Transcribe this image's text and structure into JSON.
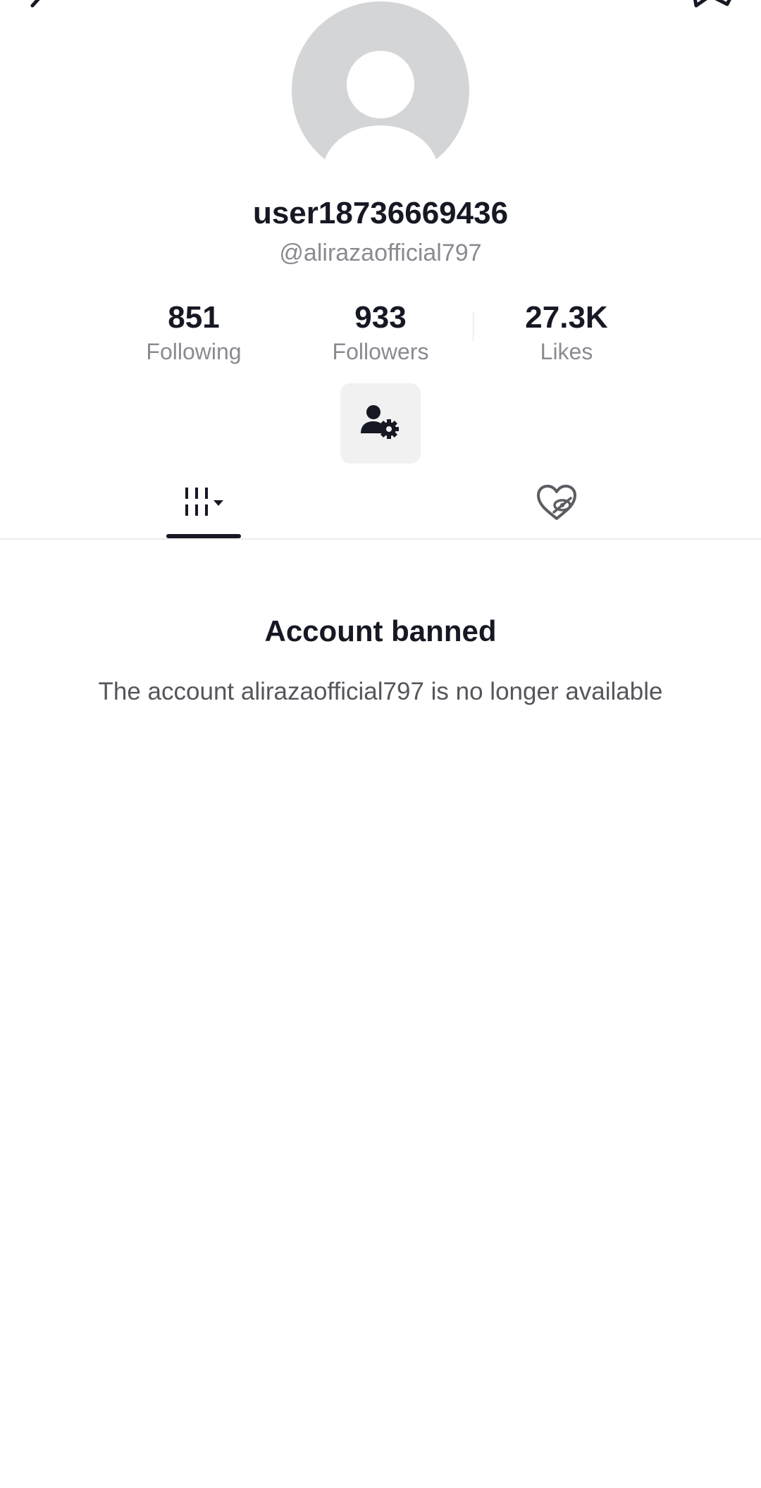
{
  "header": {
    "back_icon": "back-arrow-icon",
    "share_icon": "share-icon"
  },
  "profile": {
    "avatar_icon": "default-avatar-icon",
    "display_name": "user18736669436",
    "handle": "@alirazaofficial797"
  },
  "stats": {
    "following": {
      "value": "851",
      "label": "Following"
    },
    "followers": {
      "value": "933",
      "label": "Followers"
    },
    "likes": {
      "value": "27.3K",
      "label": "Likes"
    }
  },
  "actions": {
    "profile_settings_icon": "user-gear-icon"
  },
  "tabs": [
    {
      "icon": "videos-grid-icon",
      "selected": true
    },
    {
      "icon": "liked-heart-hidden-icon",
      "selected": false
    }
  ],
  "notice": {
    "title": "Account banned",
    "message": "The account alirazaofficial797 is no longer available"
  },
  "colors": {
    "primary_text": "#161823",
    "secondary_text": "#8a8b91",
    "avatar_bg": "#d4d5d7",
    "button_bg": "#f1f1f2"
  }
}
